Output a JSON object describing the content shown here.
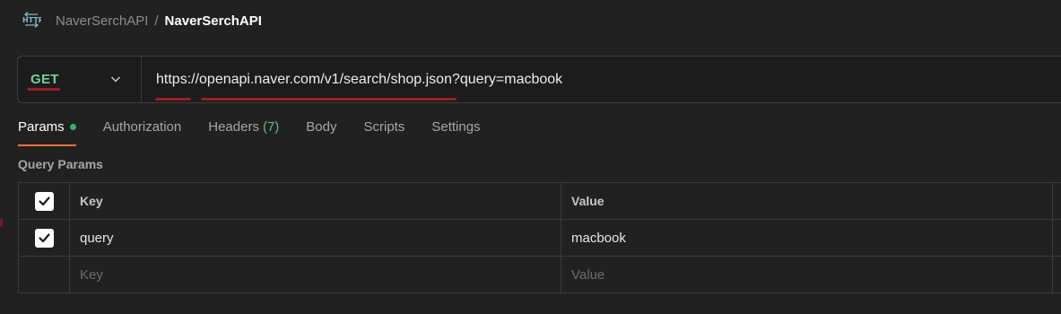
{
  "breadcrumb": {
    "icon": "http-icon",
    "parent": "NaverSerchAPI",
    "separator": "/",
    "current": "NaverSerchAPI"
  },
  "request": {
    "method": "GET",
    "url": "https://openapi.naver.com/v1/search/shop.json?query=macbook",
    "method_color": "#6fd39a"
  },
  "tabs": [
    {
      "label": "Params",
      "active": true,
      "indicator": "green-dot"
    },
    {
      "label": "Authorization"
    },
    {
      "label": "Headers",
      "count": "(7)"
    },
    {
      "label": "Body"
    },
    {
      "label": "Scripts"
    },
    {
      "label": "Settings"
    }
  ],
  "query_params": {
    "title": "Query Params",
    "columns": {
      "key": "Key",
      "value": "Value"
    },
    "rows": [
      {
        "checked": true,
        "key": "query",
        "value": "macbook"
      }
    ],
    "new_row": {
      "key_placeholder": "Key",
      "value_placeholder": "Value"
    }
  },
  "colors": {
    "accent_tab": "#ff6c37",
    "annotation_underline": "#a01c23",
    "active_dot": "#2fb36b"
  }
}
